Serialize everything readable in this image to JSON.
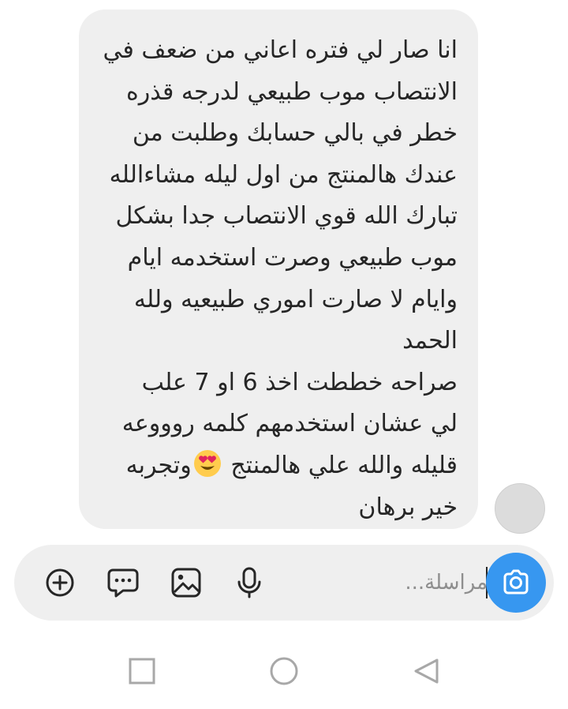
{
  "message": {
    "lines": [
      "انا صار لي فتره اعاني من ضعف في",
      "الانتصاب موب طبيعي لدرجه قذره",
      "خطر في بالي حسابك وطلبت من",
      "عندك هالمنتج من اول ليله مشاءالله",
      "تبارك الله قوي الانتصاب جدا بشكل",
      "موب طبيعي وصرت استخدمه ايام",
      "وايام لا صارت اموري طبيعيه ولله",
      "الحمد",
      "صراحه خططت اخذ 6 او 7 علب",
      "لي عشان استخدمهم كلمه روووعه"
    ],
    "emoji_line_before": "قليله والله علي هالمنتج",
    "emoji_line_after": "وتجربه",
    "last_line": "خير برهان",
    "emoji_icon": "smiling-face-with-heart-eyes"
  },
  "composer": {
    "placeholder": "مراسلة...",
    "value": "",
    "icons": [
      "add-circle-icon",
      "chat-bubble-icon",
      "image-icon",
      "microphone-icon"
    ],
    "camera_icon": "camera-icon"
  },
  "navbar": {
    "icons": [
      "recent-apps-icon",
      "home-icon",
      "back-icon"
    ]
  },
  "colors": {
    "bubble": "#efefef",
    "text": "#262626",
    "placeholder": "#8e8e8e",
    "accent": "#3797f0",
    "nav_icon": "#a8a8a8"
  }
}
